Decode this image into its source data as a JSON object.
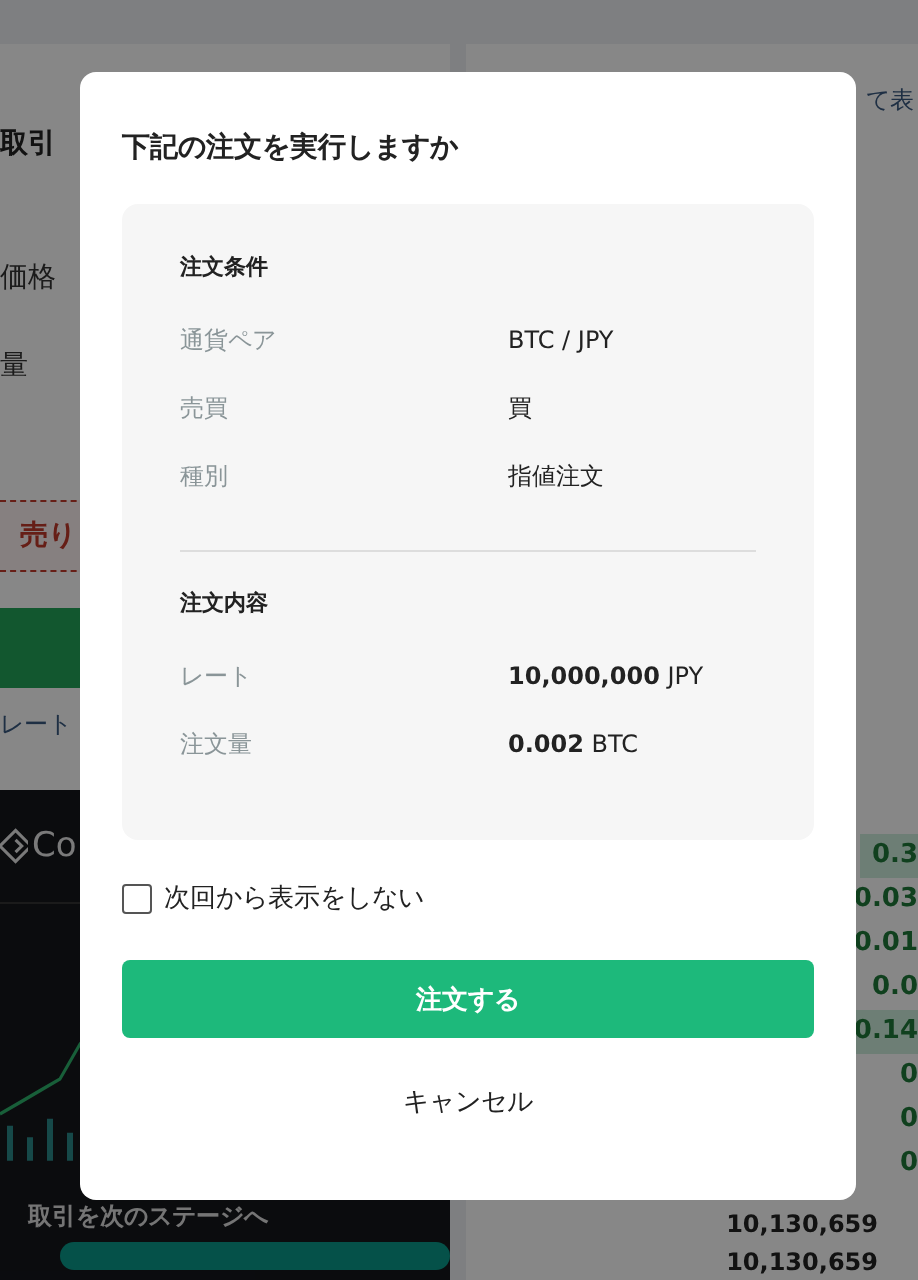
{
  "background": {
    "left_panel": {
      "title": "取引",
      "labels": [
        "価格",
        "量"
      ],
      "sell_button": "売り",
      "rate_link": "レート",
      "banner": {
        "logo_text": "Co",
        "caption": "取引を次のステージへ"
      }
    },
    "right_panel": {
      "link": "て表",
      "order_book": [
        {
          "amount": "0.3",
          "highlight": true
        },
        {
          "amount": "0.03",
          "highlight": false
        },
        {
          "amount": "0.01",
          "highlight": false
        },
        {
          "amount": "0.0",
          "highlight": false
        },
        {
          "amount": "0.14",
          "highlight": true
        },
        {
          "amount": "0",
          "highlight": false
        },
        {
          "amount": "0",
          "highlight": false
        },
        {
          "amount": "0",
          "highlight": false
        }
      ],
      "prices": [
        "10,130,659",
        "10,130,659"
      ]
    }
  },
  "dialog": {
    "title": "下記の注文を実行しますか",
    "sections": [
      {
        "heading": "注文条件",
        "rows": [
          {
            "label": "通貨ペア",
            "value": "BTC / JPY"
          },
          {
            "label": "売買",
            "value": "買"
          },
          {
            "label": "種別",
            "value": "指値注文"
          }
        ]
      },
      {
        "heading": "注文内容",
        "rows": [
          {
            "label": "レート",
            "value": "**10,000,000** JPY"
          },
          {
            "label": "注文量",
            "value": "**0.002** BTC"
          }
        ]
      }
    ],
    "dont_show_again": {
      "label": "次回から表示をしない",
      "checked": false
    },
    "confirm_button": "注文する",
    "cancel_button": "キャンセル"
  }
}
